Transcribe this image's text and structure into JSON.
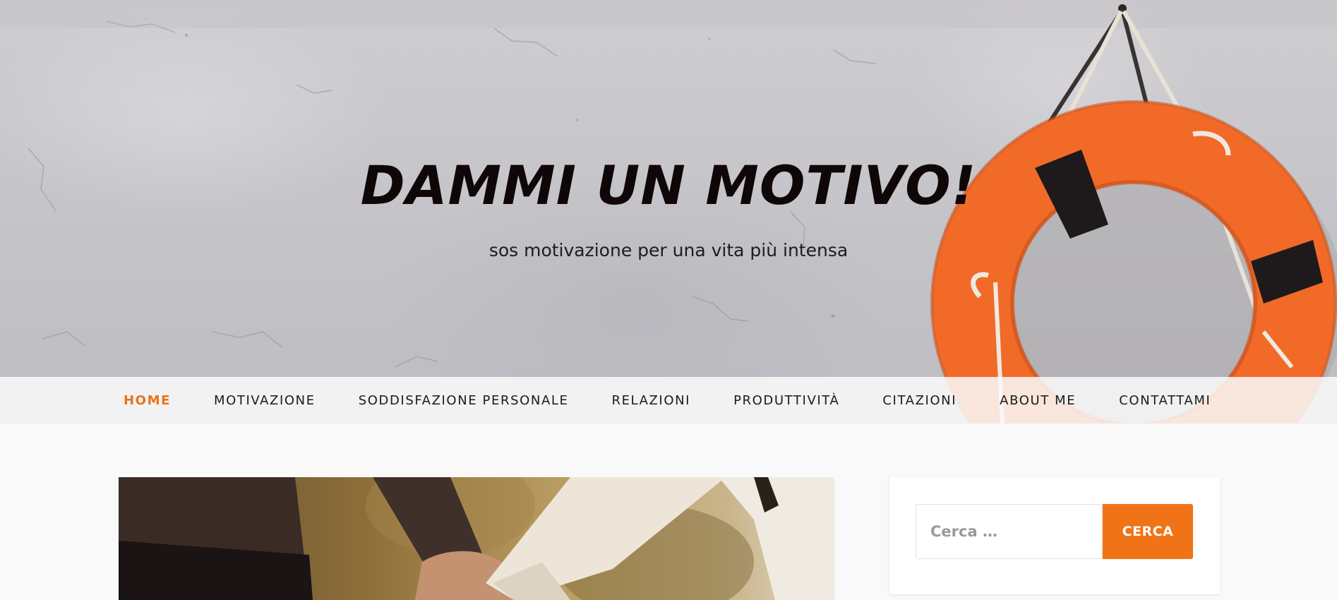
{
  "header": {
    "site_title": "DAMMI UN MOTIVO!",
    "tagline": "sos motivazione per una vita più intensa",
    "hero_image": "lifebuoy-on-white-wall"
  },
  "nav": {
    "items": [
      {
        "label": "HOME",
        "active": true
      },
      {
        "label": "MOTIVAZIONE",
        "active": false
      },
      {
        "label": "SODDISFAZIONE PERSONALE",
        "active": false
      },
      {
        "label": "RELAZIONI",
        "active": false
      },
      {
        "label": "PRODUTTIVITÀ",
        "active": false
      },
      {
        "label": "CITAZIONI",
        "active": false
      },
      {
        "label": "ABOUT ME",
        "active": false
      },
      {
        "label": "CONTATTAMI",
        "active": false
      }
    ]
  },
  "main": {
    "featured_image": "couple-holding-hands"
  },
  "sidebar": {
    "search": {
      "placeholder": "Cerca …",
      "button_label": "CERCA"
    }
  },
  "colors": {
    "accent": "#f07417",
    "nav_active": "#e8731c",
    "lifebuoy": "#f66a26"
  }
}
